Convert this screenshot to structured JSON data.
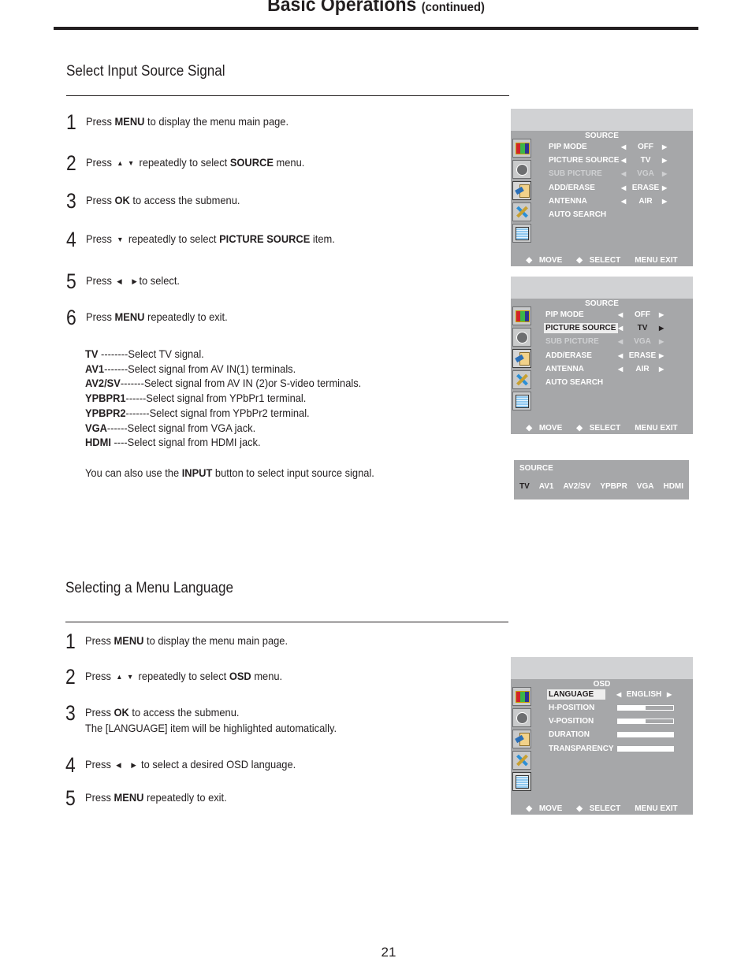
{
  "header": {
    "title": "Basic Operations",
    "subtitle": "(continued)"
  },
  "section1": {
    "title": "Select Input Source Signal",
    "steps": [
      {
        "num": "1",
        "pre": "Press ",
        "key": "MENU",
        "post": " to display the menu main page."
      },
      {
        "num": "2",
        "pre": "Press ",
        "arrows": "up-down",
        "mid": " repeatedly to select ",
        "key": "SOURCE",
        "post": " menu."
      },
      {
        "num": "3",
        "pre": "Press ",
        "key": "OK",
        "post": " to access the submenu."
      },
      {
        "num": "4",
        "pre": "Press ",
        "arrows": "down",
        "mid": " repeatedly to select ",
        "key": "PICTURE SOURCE",
        "post": " item."
      },
      {
        "num": "5",
        "pre": "Press ",
        "arrows": "left-right",
        "post": "to select."
      },
      {
        "num": "6",
        "pre": "Press ",
        "key": "MENU",
        "post": " repeatedly to exit."
      }
    ],
    "signals": [
      {
        "name": "TV",
        "desc": " --------Select TV signal."
      },
      {
        "name": "AV1",
        "desc": "-------Select signal from AV IN(1) terminals."
      },
      {
        "name": "AV2/SV",
        "desc": "-------Select signal from AV IN (2)or S-video terminals."
      },
      {
        "name": "YPBPR1",
        "desc": "------Select signal from YPbPr1 terminal."
      },
      {
        "name": "YPBPR2",
        "desc": "-------Select signal from YPbPr2 terminal."
      },
      {
        "name": "VGA",
        "desc": "------Select signal from VGA jack."
      },
      {
        "name": "HDMI",
        "desc": " ----Select signal from HDMI jack."
      }
    ],
    "note": {
      "pre": "You can also use the ",
      "key": "INPUT",
      "post": " button to select input source signal."
    }
  },
  "source_menu": {
    "title": "SOURCE",
    "rows": [
      {
        "label": "PIP MODE",
        "value": "OFF",
        "disabled": false
      },
      {
        "label": "PICTURE SOURCE",
        "value": "TV",
        "disabled": false
      },
      {
        "label": "SUB PICTURE",
        "value": "VGA",
        "disabled": true
      },
      {
        "label": "ADD/ERASE",
        "value": "ERASE",
        "disabled": false
      },
      {
        "label": "ANTENNA",
        "value": "AIR",
        "disabled": false
      },
      {
        "label": "AUTO SEARCH",
        "value": "",
        "disabled": false
      }
    ],
    "footer": {
      "move": "MOVE",
      "select": "SELECT",
      "exit": "MENU  EXIT"
    },
    "side_icons": [
      "picture-icon",
      "sound-icon",
      "source-icon",
      "setup-icon",
      "osd-icon"
    ],
    "highlighted_row_second_screen": "PICTURE SOURCE"
  },
  "source_bar": {
    "title": "SOURCE",
    "options": [
      "TV",
      "AV1",
      "AV2/SV",
      "YPBPR",
      "VGA",
      "HDMI"
    ],
    "selected": "TV"
  },
  "section2": {
    "title": "Selecting a Menu Language",
    "steps": [
      {
        "num": "1",
        "pre": "Press ",
        "key": "MENU",
        "post": " to display the menu main page."
      },
      {
        "num": "2",
        "pre": "Press ",
        "arrows": "up-down",
        "mid": " repeatedly to select ",
        "key": "OSD",
        "post": " menu."
      },
      {
        "num": "3",
        "pre": "Press ",
        "key": "OK",
        "post": " to access the submenu.",
        "line2": "The [LANGUAGE] item will be highlighted automatically."
      },
      {
        "num": "4",
        "pre": "Press ",
        "arrows": "left-right",
        "post": " to select a desired OSD language."
      },
      {
        "num": "5",
        "pre": "Press ",
        "key": "MENU",
        "post": " repeatedly to exit."
      }
    ]
  },
  "osd_menu": {
    "title": "OSD",
    "language": {
      "label": "LANGUAGE",
      "value": "ENGLISH"
    },
    "sliders": [
      {
        "label": "H-POSITION",
        "level": 0.5
      },
      {
        "label": "V-POSITION",
        "level": 0.5
      },
      {
        "label": "DURATION",
        "level": 1.0
      },
      {
        "label": "TRANSPARENCY",
        "level": 1.0
      }
    ],
    "footer": {
      "move": "MOVE",
      "select": "SELECT",
      "exit": "MENU  EXIT"
    }
  },
  "page_number": "21"
}
